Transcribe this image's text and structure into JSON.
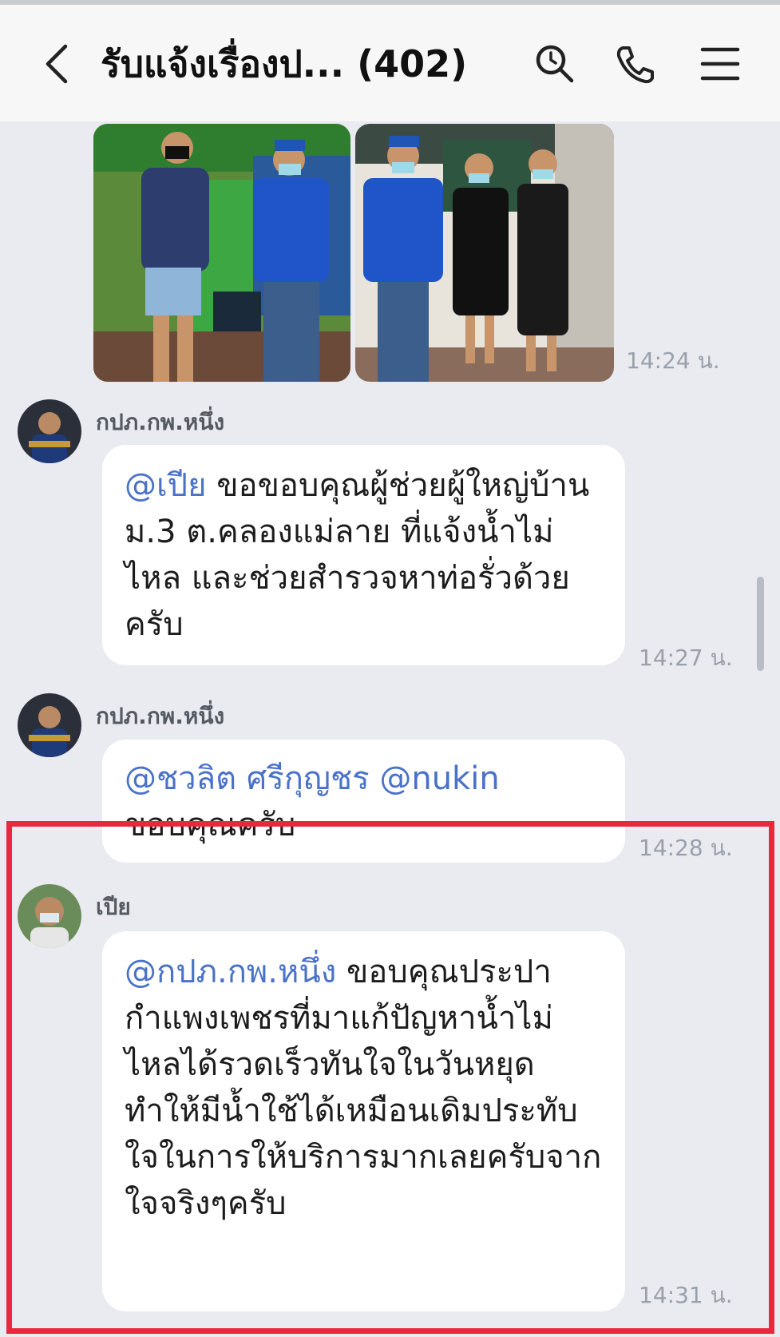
{
  "header": {
    "title": "รับแจ้งเรื่องป...  (402)",
    "icons": [
      "back-chevron-icon",
      "search-icon",
      "phone-icon",
      "menu-icon"
    ]
  },
  "photos": {
    "time": "14:24 น."
  },
  "messages": [
    {
      "sender": "กปภ.กพ.หนึ่ง",
      "mention": "@เปีย",
      "text": " ขอขอบคุณผู้ช่วยผู้ใหญ่บ้าน ม.3 ต.คลองแม่ลาย ที่แจ้งน้ำไม่ไหล และช่วยสำรวจหาท่อรั่วด้วยครับ",
      "time": "14:27 น."
    },
    {
      "sender": "กปภ.กพ.หนึ่ง",
      "mention": "@ชวลิต  ศรีกุญชร @nukin",
      "text": "ขอบคุณครับ",
      "time": "14:28 น."
    },
    {
      "sender": "เปีย",
      "mention": "@กปภ.กพ.หนึ่ง",
      "text": " ขอบคุณประปากำแพงเพชรที่มาแก้ปัญหาน้ำไม่ไหลได้รวดเร็วทันใจในวันหยุดทำให้มีน้ำใช้ได้เหมือนเดิมประทับใจในการให้บริการมากเลยครับจากใจจริงๆครับ",
      "time": "14:31 น."
    }
  ],
  "colors": {
    "mention": "#4a72c8",
    "highlight": "#e8283d",
    "background": "#e9ebf1"
  }
}
